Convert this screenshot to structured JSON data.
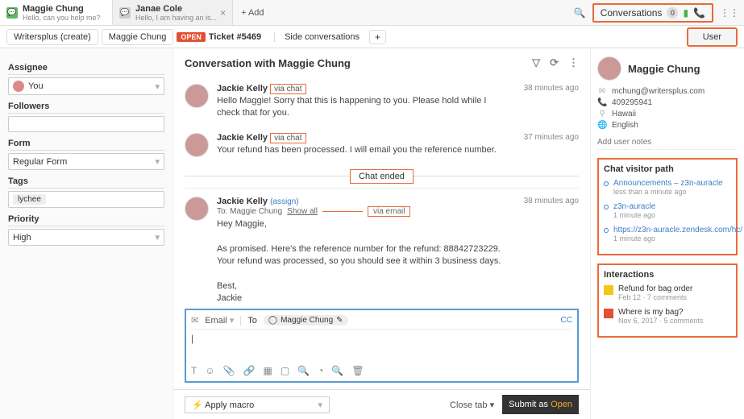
{
  "tabs": [
    {
      "title": "Maggie Chung",
      "sub": "Hello, can you help me?"
    },
    {
      "title": "Janae Cole",
      "sub": "Hello, I am having an is..."
    }
  ],
  "add_tab": "+ Add",
  "top_right": {
    "convos": "Conversations",
    "convos_count": "0"
  },
  "sub_header": {
    "crumb1": "Writersplus (create)",
    "crumb2": "Maggie Chung",
    "open": "OPEN",
    "ticket": "Ticket #5469",
    "side": "Side conversations",
    "user": "User"
  },
  "left": {
    "assignee": "Assignee",
    "you": "You",
    "followers": "Followers",
    "form": "Form",
    "form_val": "Regular Form",
    "tags": "Tags",
    "tag_val": "lychee",
    "priority": "Priority",
    "priority_val": "High"
  },
  "conv": {
    "title": "Conversation with Maggie Chung"
  },
  "messages": {
    "m1": {
      "name": "Jackie Kelly",
      "via": "via chat",
      "time": "38 minutes ago",
      "text": "Hello Maggie! Sorry that this is happening to you. Please hold while I check that for you."
    },
    "m2": {
      "name": "Jackie Kelly",
      "via": "via chat",
      "time": "37 minutes ago",
      "text": "Your refund has been processed. I will email you the reference number."
    },
    "ended": "Chat ended",
    "m3": {
      "name": "Jackie Kelly",
      "assign": "(assign)",
      "time": "38 minutes ago",
      "to_prefix": "To: Maggie Chung",
      "show_all": "Show all",
      "via": "via email",
      "body1": "Hey Maggie,",
      "body2": "As promised. Here's the reference number for the refund: 88842723229. Your refund was processed, so you should see it within 3 business days.",
      "body3": "Best,",
      "body4": "Jackie"
    }
  },
  "reply": {
    "channel": "Email",
    "to_label": "To",
    "to_chip": "Maggie Chung",
    "cc": "CC",
    "cursor": "|"
  },
  "bottom": {
    "macro": "Apply macro",
    "close": "Close tab",
    "submit_pre": "Submit as ",
    "submit_open": "Open"
  },
  "user": {
    "name": "Maggie Chung",
    "email": "mchung@writersplus.com",
    "phone": "409295941",
    "loc": "Hawaii",
    "lang": "English",
    "notes_ph": "Add user notes"
  },
  "visitor": {
    "title": "Chat visitor path",
    "p1": {
      "link": "Announcements – z3n-auracle",
      "time": "less than a minute ago"
    },
    "p2": {
      "link": "z3n-auracle",
      "time": "1 minute ago"
    },
    "p3": {
      "link": "https://z3n-auracle.zendesk.com/hc/",
      "time": "1 minute ago"
    }
  },
  "interactions": {
    "title": "Interactions",
    "i1": {
      "title": "Refund for bag order",
      "meta": "Feb 12 · 7 comments"
    },
    "i2": {
      "title": "Where is my bag?",
      "meta": "Nov 6, 2017 · 5 comments"
    }
  }
}
